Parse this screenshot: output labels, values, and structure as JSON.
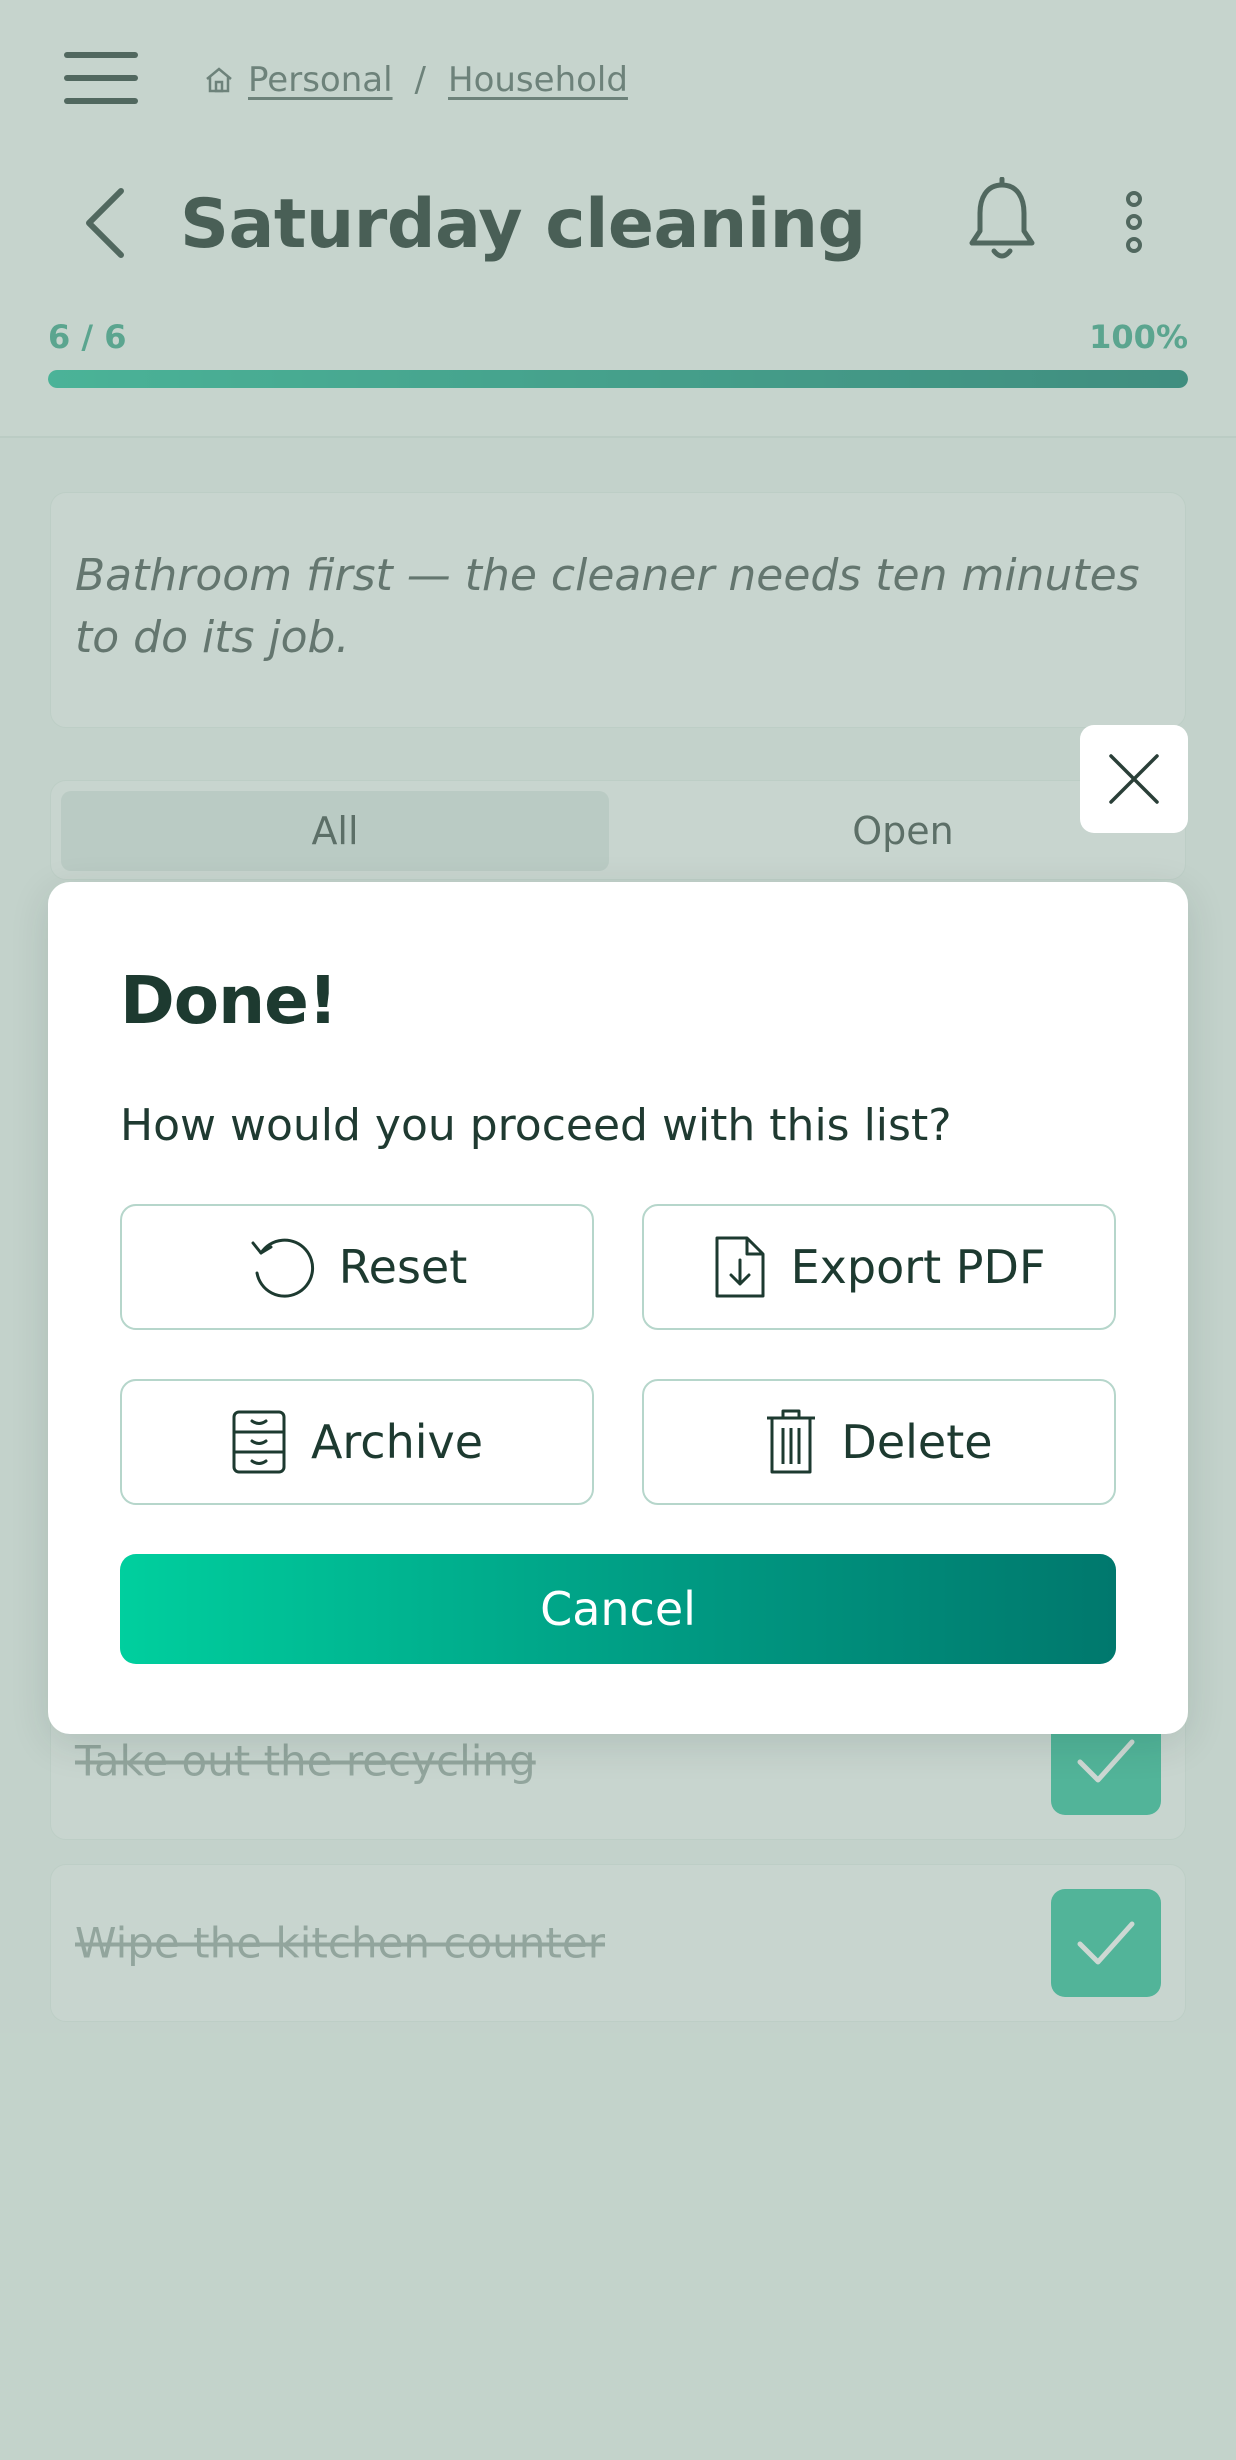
{
  "breadcrumb": {
    "items": [
      "Personal",
      "Household"
    ],
    "separator": "/"
  },
  "header": {
    "title": "Saturday cleaning"
  },
  "progress": {
    "count": "6 / 6",
    "percent_label": "100%",
    "fraction": 1.0
  },
  "note": {
    "text": "Bathroom first — the cleaner needs ten minutes to do its job."
  },
  "filters": {
    "all": "All",
    "open": "Open",
    "active": "All"
  },
  "tasks": [
    {
      "label": "Take out the recycling",
      "done": true
    },
    {
      "label": "Wipe the kitchen counter",
      "done": true
    }
  ],
  "modal": {
    "title": "Done!",
    "message": "How would you proceed with this list?",
    "actions": {
      "reset": "Reset",
      "export_pdf": "Export PDF",
      "archive": "Archive",
      "delete": "Delete"
    },
    "cancel": "Cancel"
  },
  "icons": [
    "hamburger-icon",
    "home-icon",
    "back-arrow-icon",
    "bell-icon",
    "more-vertical-icon",
    "close-icon",
    "reset-icon",
    "file-download-icon",
    "archive-icon",
    "trash-icon",
    "checkmark-icon"
  ],
  "colors": {
    "accent": "#00cf9e",
    "accent_dark": "#00786d",
    "check": "#2bc19c",
    "progress_text": "#3ca88b"
  }
}
